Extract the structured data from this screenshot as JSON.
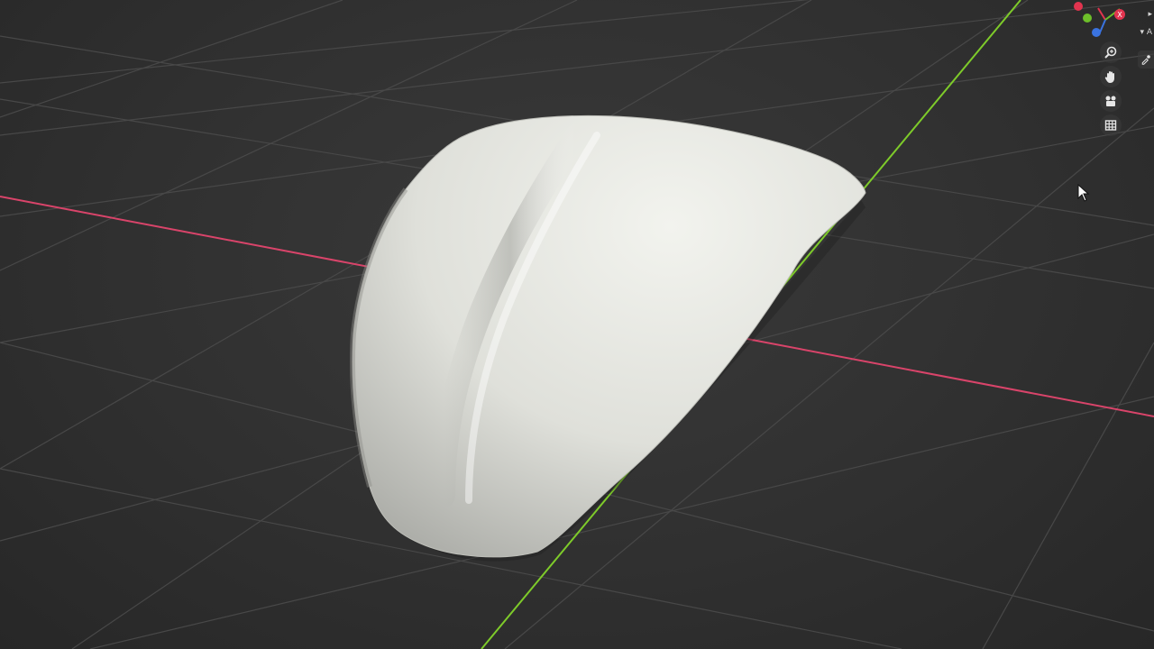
{
  "viewport": {
    "background_color": "#303030",
    "grid_color": "#4a4a4a",
    "x_axis_color": "#d9446a",
    "y_axis_color": "#7ecb2a",
    "mesh_color": "#e9ebe6"
  },
  "gizmo": {
    "axis_x_color": "#e2344f",
    "axis_y_color": "#6dbf2a",
    "axis_z_color": "#3a73e0",
    "axis_x_label": "X",
    "axis_y_label": "Y",
    "axis_z_label": "Z"
  },
  "side_tabs": [
    {
      "label": "▸"
    },
    {
      "label": "▾ A"
    }
  ],
  "nav_tools": [
    {
      "icon": "zoom-icon"
    },
    {
      "icon": "hand-pan-icon"
    },
    {
      "icon": "camera-icon"
    },
    {
      "icon": "grid-ortho-icon"
    }
  ]
}
